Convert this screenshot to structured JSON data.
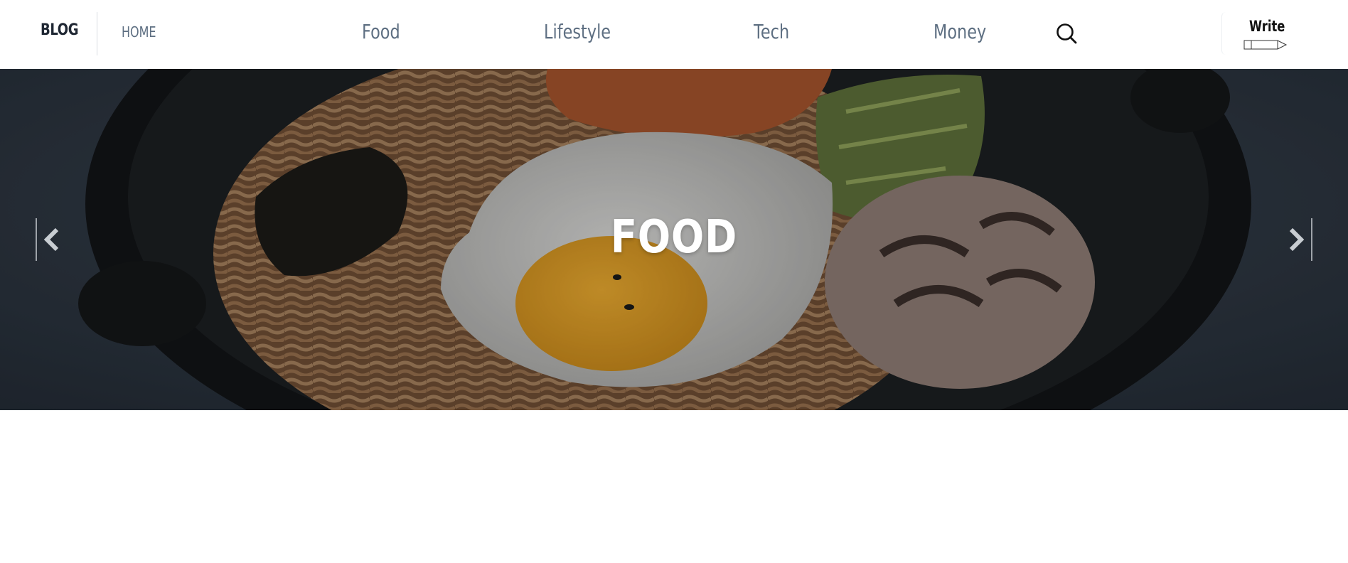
{
  "header": {
    "brand": "BLOG",
    "home_label": "HOME",
    "nav": [
      {
        "label": "Food"
      },
      {
        "label": "Lifestyle"
      },
      {
        "label": "Tech"
      },
      {
        "label": "Money"
      }
    ],
    "search_icon": "search-icon",
    "write_label": "Write",
    "write_icon": "pencil-icon"
  },
  "hero": {
    "title": "FOOD",
    "prev_icon": "chevron-left-icon",
    "next_icon": "chevron-right-icon"
  },
  "colors": {
    "nav_text": "#5e6f82",
    "brand_text": "#1f2733",
    "hero_overlay": "#2b3440"
  }
}
